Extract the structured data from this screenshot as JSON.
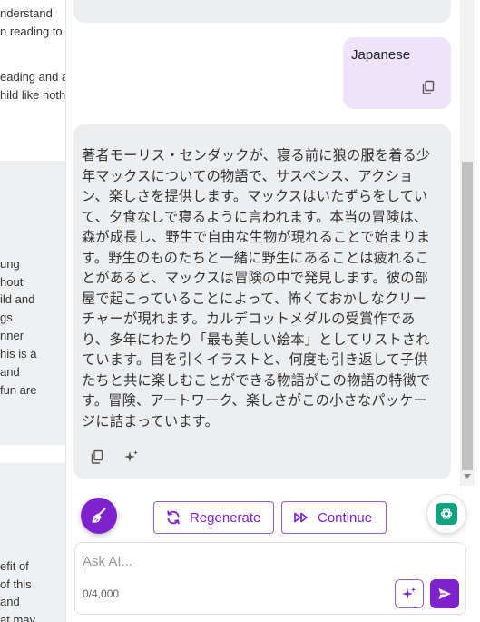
{
  "left_page": {
    "lines_top": [
      "nderstand",
      "n reading to"
    ],
    "lines_mid": [
      "eading and a",
      "hild like noth"
    ],
    "lines_band": [
      "ung",
      "hout",
      "ild and",
      "gs",
      "nner",
      "his is a",
      "and",
      "fun are"
    ],
    "lines_bottom": [
      "efit of",
      "of this",
      "and",
      "at may"
    ]
  },
  "chat": {
    "user_message": "Japanese",
    "ai_message": "著者モーリス・センダックが、寝る前に狼の服を着る少年マックスについての物語で、サスペンス、アクション、楽しさを提供します。マックスはいたずらをしていて、夕食なしで寝るように言われます。本当の冒険は、森が成長し、野生で自由な生物が現れることで始まります。野生のものたちと一緒に野生にあることは疲れることがあると、マックスは冒険の中で発見します。彼の部屋で起こっていることによって、怖くておかしなクリーチャーが現れます。カルデコットメダルの受賞作であり、多年にわたり「最も美しい絵本」としてリストされています。目を引くイラストと、何度も引き返して子供たちと共に楽しむことができる物語がこの物語の特徴です。冒険、アートワーク、楽しさがこの小さなパッケージに詰まっています。"
  },
  "actions": {
    "regenerate_label": "Regenerate",
    "continue_label": "Continue"
  },
  "input": {
    "placeholder": "Ask AI...",
    "counter": "0/4,000"
  },
  "icons": {
    "copy": "copy-icon",
    "sparkle": "sparkle-icon",
    "brush": "broom-icon",
    "regenerate": "refresh-icon",
    "continue": "fast-forward-icon",
    "chatgpt": "chatgpt-logo-icon",
    "send": "send-icon"
  },
  "colors": {
    "accent": "#7e22ce",
    "user_bubble": "#efe3fc",
    "ai_bubble": "#eceef0",
    "chatgpt_green": "#10a37f"
  }
}
